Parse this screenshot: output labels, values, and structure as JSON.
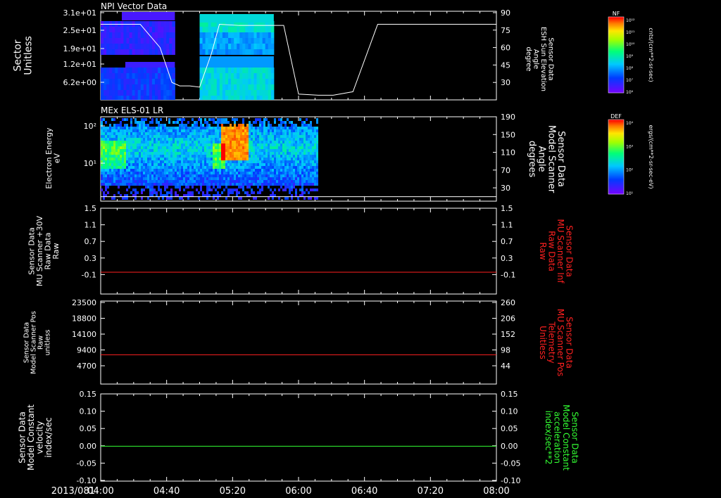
{
  "colors": {
    "white": "#ffffff",
    "red": "#ff2020",
    "green": "#33ff33",
    "background": "#000000"
  },
  "time_axis": {
    "date": "2013/081",
    "ticks": [
      "04:00",
      "04:40",
      "05:20",
      "06:00",
      "06:40",
      "07:20",
      "08:00"
    ]
  },
  "colorbars": [
    {
      "title": "NF",
      "unit": "cnts/(cm**2-sr-sec)",
      "ticks": [
        "10¹²",
        "10¹¹",
        "10¹⁰",
        "10⁹",
        "10⁸",
        "10⁷",
        "10⁶"
      ],
      "colormap": "spectrum"
    },
    {
      "title": "DEF",
      "unit": "ergs/(cm**2-sr-sec-eV)",
      "ticks": [
        "10⁴",
        "10³",
        "10²",
        "10¹"
      ],
      "colormap": "spectrum"
    }
  ],
  "chart_data": [
    {
      "type": "heatmap",
      "title": "NPI Vector Data",
      "ylabel": "Sector\nUnitless",
      "yticks": [
        "3.1e+01",
        "2.5e+01",
        "1.9e+01",
        "1.2e+01",
        "6.2e+00"
      ],
      "data_coverage_hours": [
        [
          4.0,
          4.75
        ],
        [
          5.0,
          5.75
        ]
      ],
      "line_series": {
        "name": "ESH Sun Elevation Angle",
        "ylabel_right": "Sensor Data\nESH Sun Elevation\nAngle\ndegree",
        "yticks_right": [
          "90",
          "75",
          "60",
          "45",
          "30"
        ],
        "ylim": [
          15,
          90
        ],
        "x_hours": [
          4.0,
          4.4,
          4.6,
          4.72,
          4.8,
          4.9,
          5.0,
          5.12,
          5.2,
          5.4,
          5.8,
          5.85,
          6.0,
          6.2,
          6.35,
          6.55,
          6.8,
          7.0,
          8.0
        ],
        "y": [
          80,
          80,
          60,
          30,
          27,
          27,
          26,
          55,
          80,
          79,
          79,
          79,
          20,
          19,
          19,
          22,
          80,
          80,
          80
        ]
      }
    },
    {
      "type": "heatmap",
      "title": "MEx ELS-01 LR",
      "ylabel": "Electron Energy\neV",
      "yticks": [
        "10²",
        "10¹"
      ],
      "data_coverage_hours": [
        [
          4.0,
          6.18
        ]
      ],
      "line_series": {
        "name": "Model Scanner Angle",
        "ylabel_right": "Sensor Data\nModel Scanner\nAngle\ndegrees",
        "yticks_right": [
          "190",
          "150",
          "110",
          "70",
          "30"
        ],
        "ylim": [
          0,
          190
        ],
        "x_hours": [
          4.0,
          8.0
        ],
        "y": [
          10,
          10
        ]
      }
    },
    {
      "type": "line",
      "ylabel": "Sensor Data\nMU Scanner +30V\nRaw Data\nRaw",
      "yticks": [
        "1.5",
        "1.1",
        "0.7",
        "0.3",
        "-0.1"
      ],
      "ylim": [
        -0.4,
        1.5
      ],
      "ylabel_right": "Sensor Data\nMU Scanner Inf\nRaw Data\nRaw",
      "yticks_right": [
        "1.5",
        "1.1",
        "0.7",
        "0.3",
        "-0.1"
      ],
      "series": [
        {
          "color": "red",
          "x_hours": [
            4.0,
            8.0
          ],
          "values": [
            0.0,
            0.0
          ]
        }
      ]
    },
    {
      "type": "line",
      "ylabel": "Sensor Data\nModel Scanner Pos\nRaw\nunitless",
      "yticks": [
        "23500",
        "18800",
        "14100",
        "9400",
        "4700"
      ],
      "ylim": [
        0,
        23500
      ],
      "ylabel_right": "Sensor Data\nMU Scanner Pos\nTelemetry\nUnitless",
      "yticks_right": [
        "260",
        "206",
        "152",
        "98",
        "44"
      ],
      "series": [
        {
          "color": "red",
          "x_hours": [
            4.0,
            8.0
          ],
          "values": [
            8300,
            8300
          ]
        }
      ]
    },
    {
      "type": "line",
      "ylabel": "Sensor Data\nModel Constant\nvelocity\nindex/sec",
      "yticks": [
        "0.15",
        "0.10",
        "0.05",
        "0.00",
        "-0.05",
        "-0.10"
      ],
      "ylim": [
        -0.1,
        0.15
      ],
      "ylabel_right": "Sensor Data\nModel Constant\nacceleration\nindex/sec**2",
      "yticks_right": [
        "0.15",
        "0.10",
        "0.05",
        "0.00",
        "-0.05",
        "-0.10"
      ],
      "series": [
        {
          "color": "green",
          "x_hours": [
            4.0,
            8.0
          ],
          "values": [
            0.0,
            0.0
          ]
        }
      ]
    }
  ]
}
